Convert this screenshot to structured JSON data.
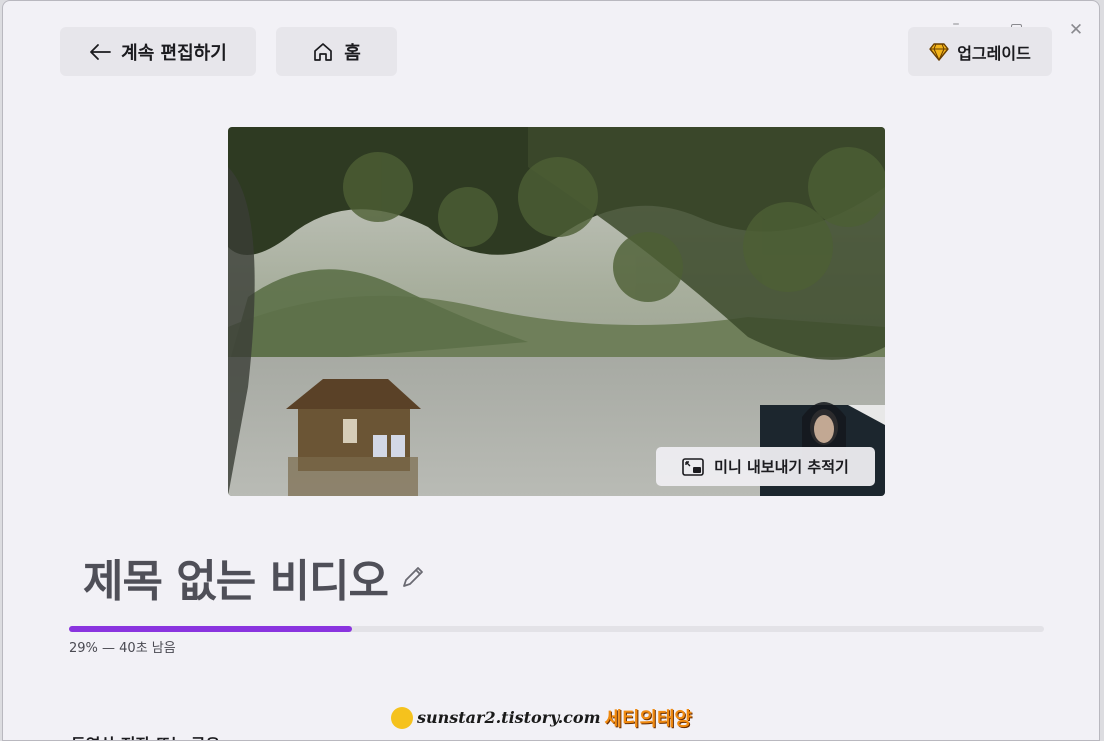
{
  "window_controls": {
    "minimize": "–",
    "close": "✕"
  },
  "toolbar": {
    "back_label": "계속 편집하기",
    "home_label": "홈",
    "upgrade_label": "업그레이드"
  },
  "icons": {
    "back": "arrow-left-icon",
    "home": "home-icon",
    "upgrade": "diamond-icon",
    "tracker": "picture-in-picture-icon",
    "edit": "pencil-icon"
  },
  "preview": {
    "tracker_label": "미니 내보내기 추적기"
  },
  "video": {
    "title": "제목 없는 비디오"
  },
  "progress": {
    "percent": 29,
    "status_text": "29% — 40초 남음"
  },
  "section": {
    "partial_label": "동영상 저장 또는 공유"
  },
  "watermark": {
    "url_text": "sunstar2.tistory.com",
    "name_text": "세티의태양"
  },
  "colors": {
    "accent": "#8a34df",
    "background": "#f2f1f6",
    "button_bg": "#e7e6eb"
  }
}
